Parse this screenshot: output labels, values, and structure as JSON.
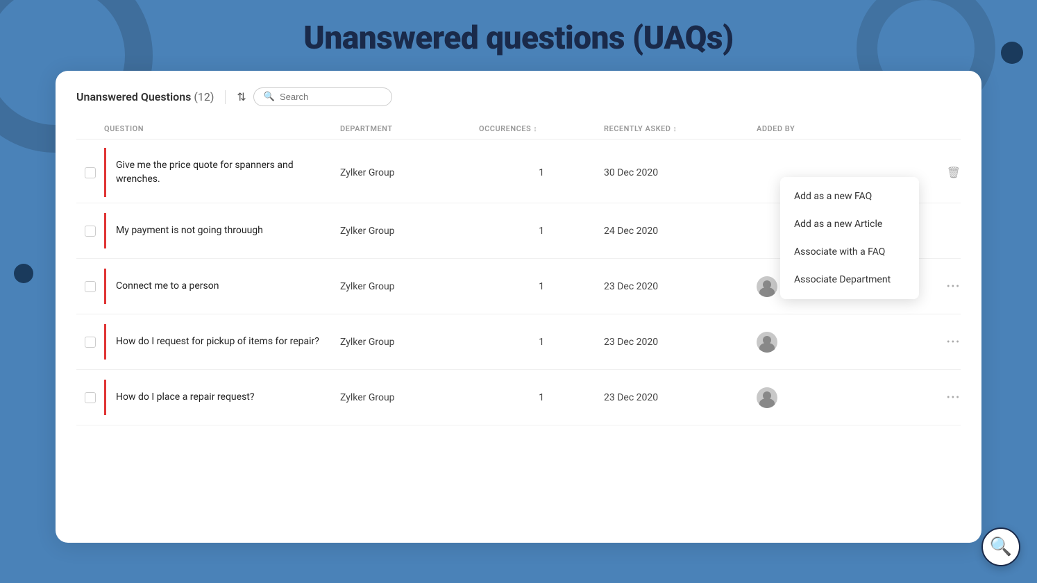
{
  "page": {
    "title": "Unanswered questions (UAQs)",
    "bg_color": "#4a82b8"
  },
  "header": {
    "table_title": "Unanswered Questions",
    "count": "(12)",
    "search_placeholder": "Search"
  },
  "columns": [
    {
      "id": "checkbox",
      "label": ""
    },
    {
      "id": "question",
      "label": "QUESTION"
    },
    {
      "id": "department",
      "label": "DEPARTMENT"
    },
    {
      "id": "occurrences",
      "label": "OCCURENCES",
      "sortable": true
    },
    {
      "id": "recently_asked",
      "label": "RECENTLY ASKED",
      "sortable": true
    },
    {
      "id": "added_by",
      "label": "ADDED BY"
    },
    {
      "id": "actions",
      "label": ""
    }
  ],
  "rows": [
    {
      "id": 1,
      "question": "Give me the price quote for spanners and wrenches.",
      "department": "Zylker Group",
      "occurrences": "1",
      "recently_asked": "30 Dec 2020",
      "added_by_type": "dropdown",
      "has_dropdown": true
    },
    {
      "id": 2,
      "question": "My payment is not going throuugh",
      "department": "Zylker Group",
      "occurrences": "1",
      "recently_asked": "24 Dec 2020",
      "added_by_type": "dropdown",
      "has_dropdown": false
    },
    {
      "id": 3,
      "question": "Connect me to a person",
      "department": "Zylker Group",
      "occurrences": "1",
      "recently_asked": "23 Dec 2020",
      "added_by_type": "avatar",
      "has_dropdown": false
    },
    {
      "id": 4,
      "question": "How do I request for pickup of items for repair?",
      "department": "Zylker Group",
      "occurrences": "1",
      "recently_asked": "23 Dec 2020",
      "added_by_type": "avatar",
      "has_dropdown": false
    },
    {
      "id": 5,
      "question": "How do I place a repair request?",
      "department": "Zylker Group",
      "occurrences": "1",
      "recently_asked": "23 Dec 2020",
      "added_by_type": "avatar",
      "has_dropdown": false
    }
  ],
  "dropdown_menu": {
    "items": [
      "Add as a new FAQ",
      "Add as a new Article",
      "Associate with a FAQ",
      "Associate Department"
    ]
  }
}
